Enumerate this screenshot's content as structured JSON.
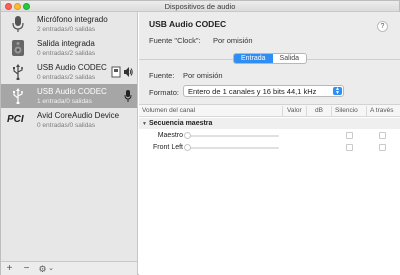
{
  "window": {
    "title": "Dispositivos de audio"
  },
  "sidebar": {
    "devices": [
      {
        "name": "Micrófono integrado",
        "sub": "2 entradas/0 salidas",
        "icon": "microphone-icon"
      },
      {
        "name": "Salida integrada",
        "sub": "0 entradas/2 salidas",
        "icon": "speaker-icon"
      },
      {
        "name": "USB Audio CODEC",
        "sub": "0 entradas/2 salidas",
        "icon": "usb-icon"
      },
      {
        "name": "USB Audio CODEC",
        "sub": "1 entrada/0 salidas",
        "icon": "usb-icon"
      },
      {
        "name": "Avid CoreAudio Device",
        "sub": "0 entradas/0 salidas",
        "icon": "pci-icon",
        "icon_text": "PCI"
      }
    ],
    "bottom": {
      "add": "+",
      "remove": "−",
      "gear": "⚙",
      "gear_arrow": "⌄"
    }
  },
  "main": {
    "device_title": "USB Audio CODEC",
    "help_label": "?",
    "clock_label": "Fuente \"Clock\":",
    "clock_value": "Por omisión",
    "tabs": [
      {
        "label": "Entrada",
        "active": true
      },
      {
        "label": "Salida",
        "active": false
      }
    ],
    "source_label": "Fuente:",
    "source_value": "Por omisión",
    "format_label": "Formato:",
    "format_value": "Entero de 1 canales y 16 bits 44,1 kHz",
    "volume_table": {
      "headers": {
        "channel": "Volumen del canal",
        "value": "Valor",
        "db": "dB",
        "mute": "Silencio",
        "thru": "A través"
      },
      "group": "Secuencia maestra",
      "rows": [
        {
          "label": "Maestro"
        },
        {
          "label": "Front Left"
        }
      ]
    }
  },
  "colors": {
    "accent": "#2e8ef3",
    "selected_row": "#a6a6a6"
  }
}
